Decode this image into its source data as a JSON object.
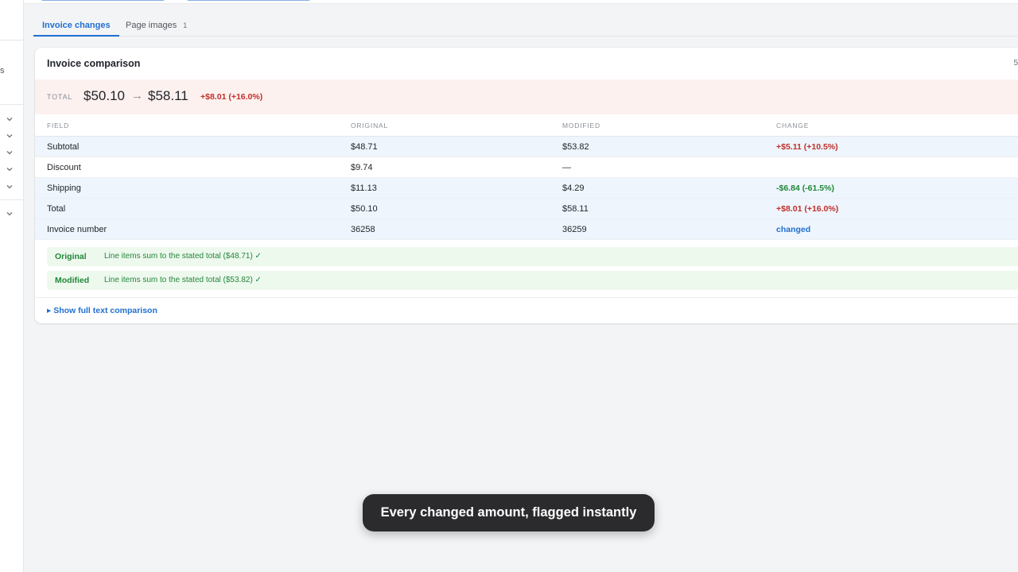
{
  "left_rail": {
    "partial_label": "s"
  },
  "tabs": [
    {
      "label": "Invoice changes",
      "count": ""
    },
    {
      "label": "Page images",
      "count": "1"
    }
  ],
  "card": {
    "title": "Invoice comparison",
    "corner_text": "5",
    "total": {
      "label": "TOTAL",
      "original": "$50.10",
      "arrow": "→",
      "modified": "$58.11",
      "delta": "+$8.01 (+16.0%)"
    },
    "columns": [
      "FIELD",
      "ORIGINAL",
      "MODIFIED",
      "CHANGE"
    ],
    "rows": [
      {
        "field": "Subtotal",
        "original": "$48.71",
        "modified": "$53.82",
        "change": "+$5.11 (+10.5%)"
      },
      {
        "field": "Discount",
        "original": "$9.74",
        "modified": "—",
        "change": ""
      },
      {
        "field": "Shipping",
        "original": "$11.13",
        "modified": "$4.29",
        "change": "-$6.84 (-61.5%)"
      },
      {
        "field": "Total",
        "original": "$50.10",
        "modified": "$58.11",
        "change": "+$8.01 (+16.0%)"
      },
      {
        "field": "Invoice number",
        "original": "36258",
        "modified": "36259",
        "change": "changed"
      }
    ],
    "checks": [
      {
        "label": "Original",
        "text": "Line items sum to the stated total ($48.71) ✓"
      },
      {
        "label": "Modified",
        "text": "Line items sum to the stated total ($53.82) ✓"
      }
    ],
    "show_full_label": "▸ Show full text comparison"
  },
  "toast": {
    "text": "Every changed amount, flagged instantly"
  },
  "colors": {
    "accent": "#1f6fd1",
    "increase": "#c0302b",
    "decrease": "#22863a",
    "total_band_bg": "#fdf1ef",
    "check_bg": "#eef9ee"
  },
  "icons": {
    "left_rail_expanders": "chevron-down-icon"
  }
}
